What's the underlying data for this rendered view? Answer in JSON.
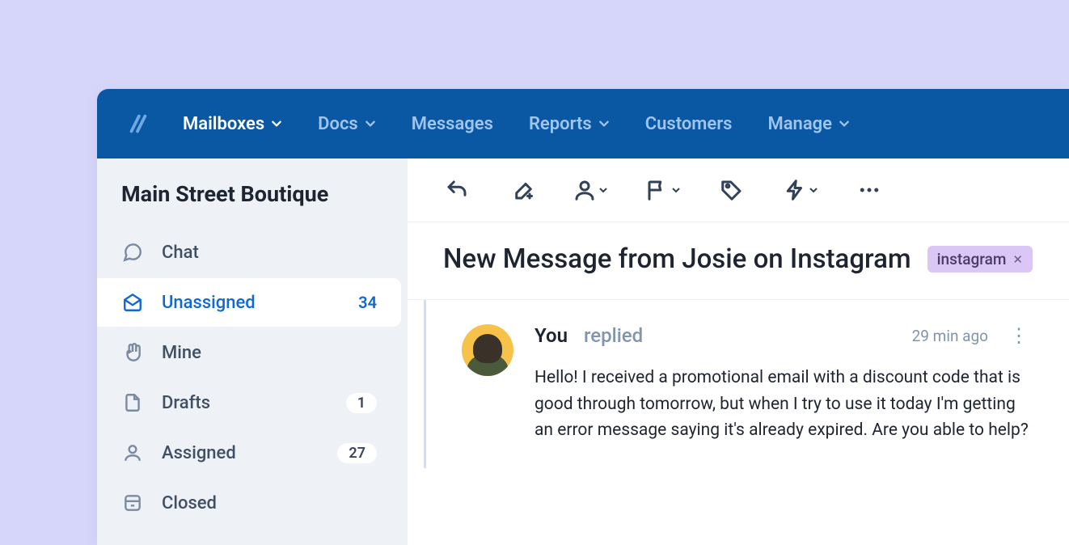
{
  "nav": {
    "items": [
      {
        "label": "Mailboxes",
        "caret": true,
        "active": true
      },
      {
        "label": "Docs",
        "caret": true,
        "active": false
      },
      {
        "label": "Messages",
        "caret": false,
        "active": false
      },
      {
        "label": "Reports",
        "caret": true,
        "active": false
      },
      {
        "label": "Customers",
        "caret": false,
        "active": false
      },
      {
        "label": "Manage",
        "caret": true,
        "active": false
      }
    ]
  },
  "sidebar": {
    "title": "Main Street Boutique",
    "items": [
      {
        "icon": "chat",
        "label": "Chat",
        "count": "",
        "pill": "",
        "active": false
      },
      {
        "icon": "inbox",
        "label": "Unassigned",
        "count": "34",
        "pill": "",
        "active": true
      },
      {
        "icon": "hand",
        "label": "Mine",
        "count": "",
        "pill": "",
        "active": false
      },
      {
        "icon": "drafts",
        "label": "Drafts",
        "count": "",
        "pill": "1",
        "active": false
      },
      {
        "icon": "person",
        "label": "Assigned",
        "count": "",
        "pill": "27",
        "active": false
      },
      {
        "icon": "archive",
        "label": "Closed",
        "count": "",
        "pill": "",
        "active": false
      }
    ]
  },
  "conversation": {
    "subject": "New Message from Josie on Instagram",
    "tag": "instagram",
    "message": {
      "author": "You",
      "action": "replied",
      "time": "29 min ago",
      "body": "Hello! I received a promotional email with a discount code that is good through tomorrow, but when I try to use it today I'm getting an error message saying it's already expired. Are you able to help?"
    }
  }
}
